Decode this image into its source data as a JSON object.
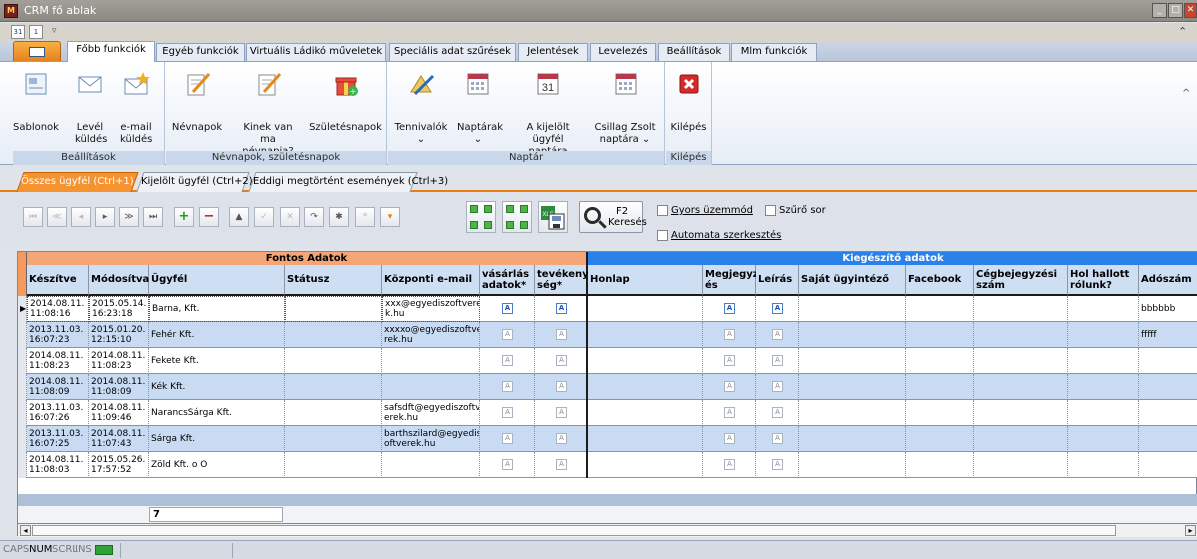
{
  "window": {
    "title": "CRM fő ablak",
    "minimize": "_",
    "maximize": "□",
    "close": "✕"
  },
  "qat": {
    "btn1": "31",
    "btn2": "1",
    "more": "▿",
    "expand": "⌃"
  },
  "ribbon_tabs": [
    "Főbb funkciók",
    "Egyéb funkciók",
    "Virtuális Ládikó műveletek",
    "Speciális adat szűrések",
    "Jelentések",
    "Levelezés",
    "Beállítások",
    "Mlm funkciók"
  ],
  "ribbon": {
    "groups": [
      {
        "label": "Beállítások",
        "buttons": [
          "Sablonok",
          "Levél küldés",
          "e-mail küldés"
        ]
      },
      {
        "label": "Névnapok, születésnapok",
        "buttons": [
          "Névnapok",
          "Kinek van ma névnapja?",
          "Születésnapok"
        ]
      },
      {
        "label": "Naptár",
        "buttons": [
          "Tennivalók ⌄",
          "Naptárak ⌄",
          "A kijelölt ügyfél naptára",
          "Csillag Zsolt naptára ⌄"
        ]
      },
      {
        "label": "Kilépés",
        "buttons": [
          "Kilépés"
        ]
      }
    ],
    "calendar_day": "31"
  },
  "subtabs": [
    "Összes ügyfél (Ctrl+1)",
    "Kijelölt ügyfél (Ctrl+2)",
    "Eddigi megtörtént események (Ctrl+3)"
  ],
  "toolbar": {
    "nav": [
      "⏮",
      "≪",
      "◂",
      "▸",
      "≫",
      "⏭",
      "+",
      "−",
      "▲",
      "✓",
      "✕",
      "↷",
      "✱",
      "*",
      "▾"
    ],
    "search_key": "F2",
    "search_label": "Keresés",
    "gyors": "Gyors üzemmód",
    "szuro": "Szűrő sor",
    "auto": "Automata szerkesztés"
  },
  "grid": {
    "band_fontos": "Fontos Adatok",
    "band_kieg": "Kiegészítő adatok",
    "columns": [
      "Készítve",
      "Módosítva",
      "Ügyfél",
      "Státusz",
      "Központi e-mail",
      "vásárlás adatok*",
      "tevékeny ség*",
      "Honlap",
      "Megjegyz és",
      "Leírás",
      "Saját ügyintéző",
      "Facebook",
      "Cégbejegyzési szám",
      "Hol hallott rólunk?",
      "Adószám"
    ],
    "rows": [
      {
        "created": "2014.08.11. 11:08:16",
        "modified": "2015.05.14. 16:23:18",
        "client": "Barna, Kft.",
        "status": "",
        "email": "xxx@egyediszoftvere k.hu",
        "tax": "bbbbbb"
      },
      {
        "created": "2013.11.03. 16:07:23",
        "modified": "2015.01.20. 12:15:10",
        "client": "Fehér Kft.",
        "status": "",
        "email": "xxxxo@egyediszoftve rek.hu",
        "tax": "fffff"
      },
      {
        "created": "2014.08.11. 11:08:23",
        "modified": "2014.08.11. 11:08:23",
        "client": "Fekete Kft.",
        "status": "",
        "email": "",
        "tax": ""
      },
      {
        "created": "2014.08.11. 11:08:09",
        "modified": "2014.08.11. 11:08:09",
        "client": "Kék Kft.",
        "status": "",
        "email": "",
        "tax": ""
      },
      {
        "created": "2013.11.03. 16:07:26",
        "modified": "2014.08.11. 11:09:46",
        "client": "NarancsSárga Kft.",
        "status": "",
        "email": "safsdft@egyediszoftv erek.hu",
        "tax": ""
      },
      {
        "created": "2013.11.03. 16:07:25",
        "modified": "2014.08.11. 11:07:43",
        "client": "Sárga Kft.",
        "status": "",
        "email": "barthszilard@egyedisz oftverek.hu",
        "tax": ""
      },
      {
        "created": "2014.08.11. 11:08:03",
        "modified": "2015.05.26. 17:57:52",
        "client": "Zöld Kft. o O",
        "status": "",
        "email": "",
        "tax": ""
      }
    ],
    "count": "7",
    "scroll_left": "◂",
    "scroll_right": "▸"
  },
  "status": {
    "caps": "CAPS",
    "num": "NUM",
    "scrl": "SCRL",
    "ins": "INS"
  }
}
